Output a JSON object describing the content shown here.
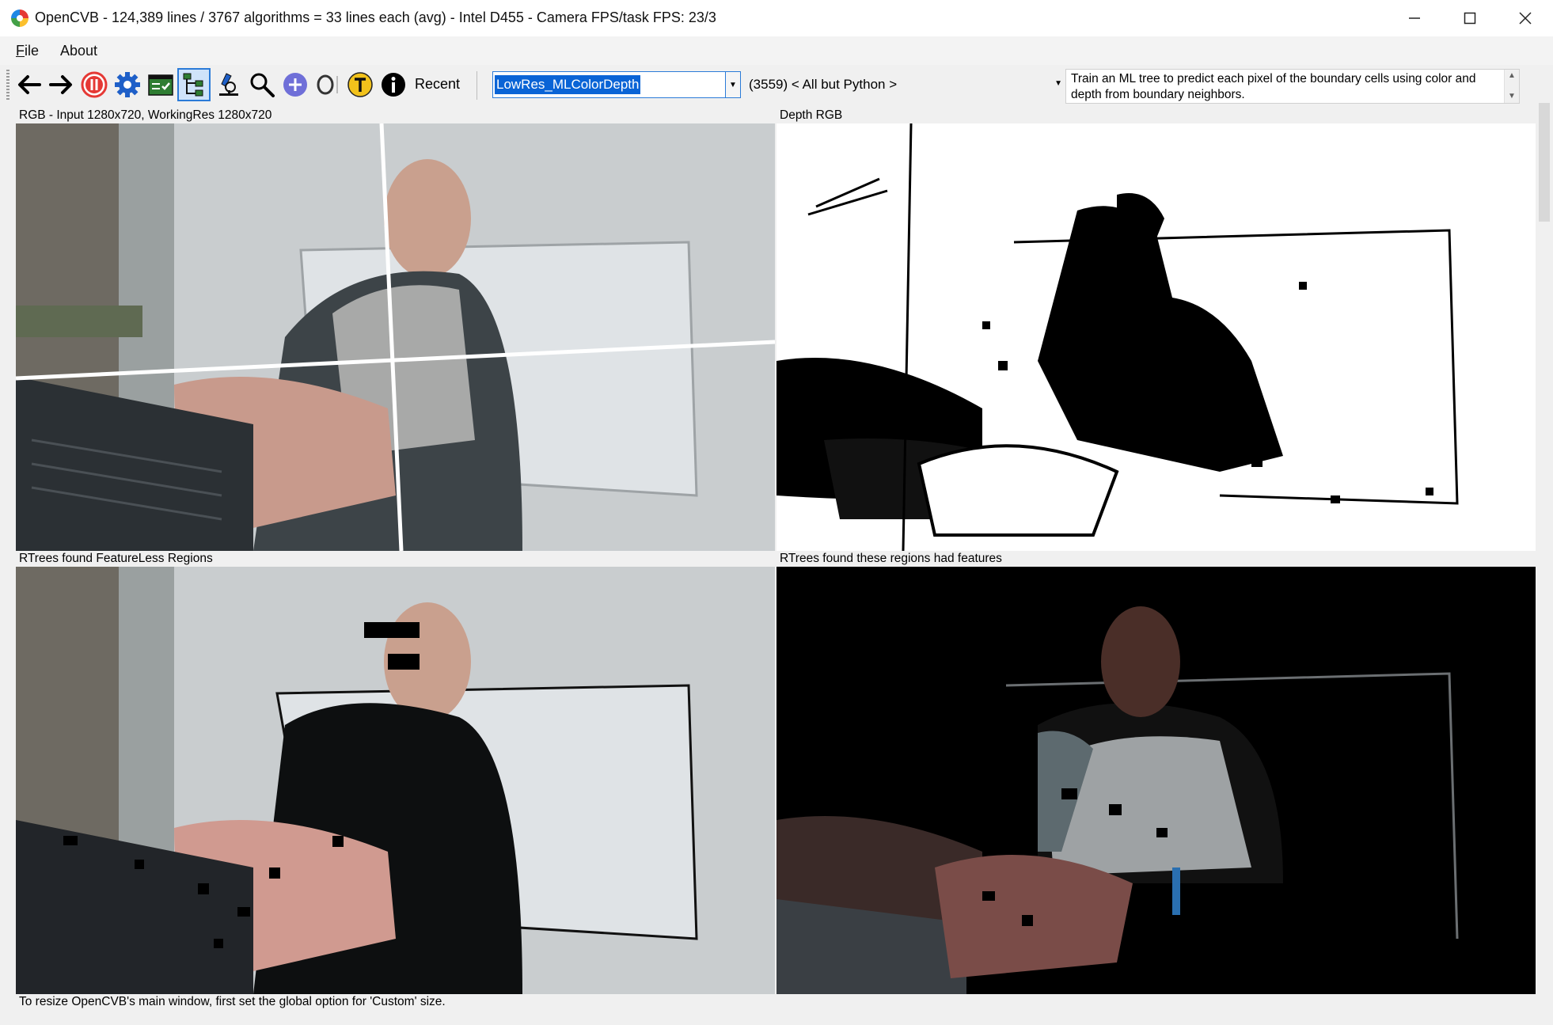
{
  "window": {
    "title": "OpenCVB - 124,389 lines / 3767 algorithms = 33 lines each (avg) - Intel D455 - Camera FPS/task FPS: 23/3"
  },
  "menu": {
    "file": "File",
    "about": "About"
  },
  "toolbar": {
    "recent_label": "Recent",
    "algorithm_value": "LowRes_MLColorDepth",
    "group_value": "(3559) < All but Python >",
    "description": "Train an ML tree to predict each pixel of the boundary cells using color and depth from boundary neighbors."
  },
  "panels": {
    "top_left_label": "RGB - Input 1280x720, WorkingRes 1280x720",
    "top_right_label": "Depth RGB",
    "bottom_left_label": "RTrees found FeatureLess Regions",
    "bottom_right_label": "RTrees found these regions had features"
  },
  "status": "To resize OpenCVB's main window, first set the global option for 'Custom' size.",
  "colors": {
    "accent": "#0a64d6",
    "pause_red": "#e53935",
    "gear_blue": "#1e5fc8",
    "plus_purple": "#6f6fd8",
    "t_yellow": "#f2c21b"
  }
}
